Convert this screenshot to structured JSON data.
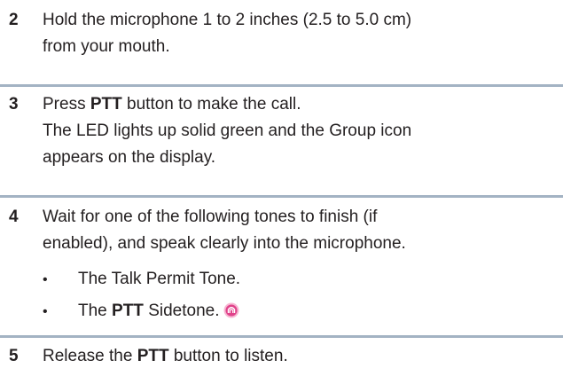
{
  "steps": [
    {
      "number": "2",
      "lines": [
        "Hold the microphone 1 to 2 inches (2.5 to 5.0 cm)",
        "from your mouth."
      ]
    },
    {
      "number": "3",
      "line1_pre": "Press ",
      "line1_bold": "PTT",
      "line1_post": " button to make the call.",
      "lines": [
        "The LED lights up solid green and the Group icon",
        "appears on the display."
      ]
    },
    {
      "number": "4",
      "lines": [
        "Wait for one of the following tones to finish (if",
        "enabled), and speak clearly into the microphone."
      ],
      "bullets": [
        {
          "text": "The Talk Permit Tone."
        },
        {
          "pre": "The ",
          "bold": "PTT",
          "post": " Sidetone."
        }
      ],
      "bullet_char": "•"
    },
    {
      "number": "5",
      "pre": "Release the ",
      "bold": "PTT",
      "post": " button to listen."
    }
  ],
  "colors": {
    "text": "#231f20",
    "divider": "#a3b3c3",
    "icon_fill": "#e0428a",
    "icon_ring": "#f7b6d2"
  },
  "icons": {
    "sidetone": "sidetone-icon"
  }
}
